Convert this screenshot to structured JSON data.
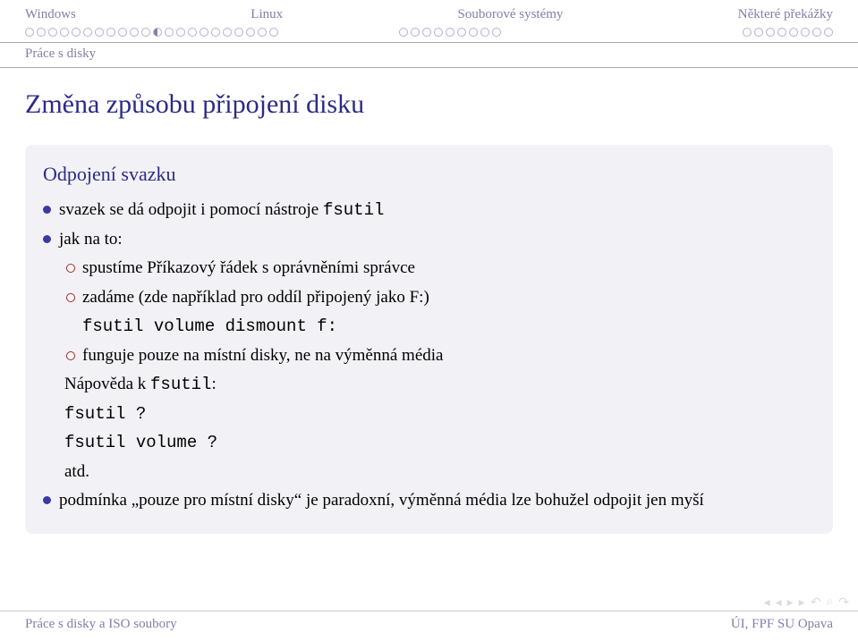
{
  "nav": {
    "a": "Windows",
    "b": "Linux",
    "c": "Souborové systémy",
    "d": "Některé překážky"
  },
  "subsection": "Práce s disky",
  "main": {
    "title": "Změna způsobu připojení disku",
    "block_title": "Odpojení svazku",
    "item1_a": "svazek se dá odpojit i pomocí nástroje ",
    "item1_b": "fsutil",
    "item2": "jak na to:",
    "sub1": "spustíme Příkazový řádek s oprávněními správce",
    "sub2": "zadáme (zde například pro oddíl připojený jako F:)",
    "sub2_cmd": "fsutil volume dismount f:",
    "sub3": "funguje pouze na místní disky, ne na výměnná média",
    "help_a": "Nápověda k ",
    "help_b": "fsutil",
    "help_c": ":",
    "cmd1": "fsutil ?",
    "cmd2": "fsutil volume ?",
    "cmd3": "atd.",
    "item3": "podmínka „pouze pro místní disky“ je paradoxní, výměnná média lze bohužel odpojit jen myší"
  },
  "footer": {
    "left": "Práce s disky a ISO soubory",
    "right": "ÚI, FPF SU Opava"
  }
}
